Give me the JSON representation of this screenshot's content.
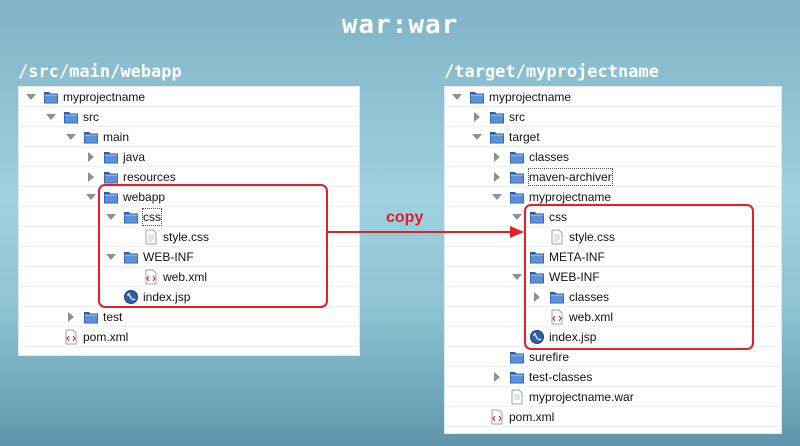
{
  "title": "war:war",
  "arrow_label": "copy",
  "accent_color": "#e0202a",
  "left_panel": {
    "title": "/src/main/webapp",
    "rows": [
      {
        "label": "myprojectname",
        "depth": 0,
        "expander": "down",
        "icon": "folder-icon"
      },
      {
        "label": "src",
        "depth": 1,
        "expander": "down",
        "icon": "folder-icon"
      },
      {
        "label": "main",
        "depth": 2,
        "expander": "down",
        "icon": "folder-icon"
      },
      {
        "label": "java",
        "depth": 3,
        "expander": "right",
        "icon": "folder-icon"
      },
      {
        "label": "resources",
        "depth": 3,
        "expander": "right",
        "icon": "folder-icon"
      },
      {
        "label": "webapp",
        "depth": 3,
        "expander": "down",
        "icon": "folder-icon"
      },
      {
        "label": "css",
        "depth": 4,
        "expander": "down",
        "icon": "folder-icon",
        "selected": true
      },
      {
        "label": "style.css",
        "depth": 5,
        "expander": "",
        "icon": "css-file-icon"
      },
      {
        "label": "WEB-INF",
        "depth": 4,
        "expander": "down",
        "icon": "folder-icon"
      },
      {
        "label": "web.xml",
        "depth": 5,
        "expander": "",
        "icon": "xml-file-icon"
      },
      {
        "label": "index.jsp",
        "depth": 4,
        "expander": "",
        "icon": "jsp-file-icon"
      },
      {
        "label": "test",
        "depth": 2,
        "expander": "right",
        "icon": "folder-icon"
      },
      {
        "label": "pom.xml",
        "depth": 1,
        "expander": "",
        "icon": "xml-file-icon"
      }
    ]
  },
  "right_panel": {
    "title": "/target/myprojectname",
    "rows": [
      {
        "label": "myprojectname",
        "depth": 0,
        "expander": "down",
        "icon": "folder-icon"
      },
      {
        "label": "src",
        "depth": 1,
        "expander": "right",
        "icon": "folder-icon"
      },
      {
        "label": "target",
        "depth": 1,
        "expander": "down",
        "icon": "folder-icon"
      },
      {
        "label": "classes",
        "depth": 2,
        "expander": "right",
        "icon": "folder-icon"
      },
      {
        "label": "maven-archiver",
        "depth": 2,
        "expander": "right",
        "icon": "folder-icon",
        "selected": true
      },
      {
        "label": "myprojectname",
        "depth": 2,
        "expander": "down",
        "icon": "folder-icon"
      },
      {
        "label": "css",
        "depth": 3,
        "expander": "down",
        "icon": "folder-icon"
      },
      {
        "label": "style.css",
        "depth": 4,
        "expander": "",
        "icon": "css-file-icon"
      },
      {
        "label": "META-INF",
        "depth": 3,
        "expander": "",
        "icon": "folder-icon"
      },
      {
        "label": "WEB-INF",
        "depth": 3,
        "expander": "down",
        "icon": "folder-icon"
      },
      {
        "label": "classes",
        "depth": 4,
        "expander": "right",
        "icon": "folder-icon"
      },
      {
        "label": "web.xml",
        "depth": 4,
        "expander": "",
        "icon": "xml-file-icon"
      },
      {
        "label": "index.jsp",
        "depth": 3,
        "expander": "",
        "icon": "jsp-file-icon"
      },
      {
        "label": "surefire",
        "depth": 2,
        "expander": "",
        "icon": "folder-icon"
      },
      {
        "label": "test-classes",
        "depth": 2,
        "expander": "right",
        "icon": "folder-icon"
      },
      {
        "label": "myprojectname.war",
        "depth": 2,
        "expander": "",
        "icon": "file-icon"
      },
      {
        "label": "pom.xml",
        "depth": 1,
        "expander": "",
        "icon": "xml-file-icon"
      }
    ]
  }
}
